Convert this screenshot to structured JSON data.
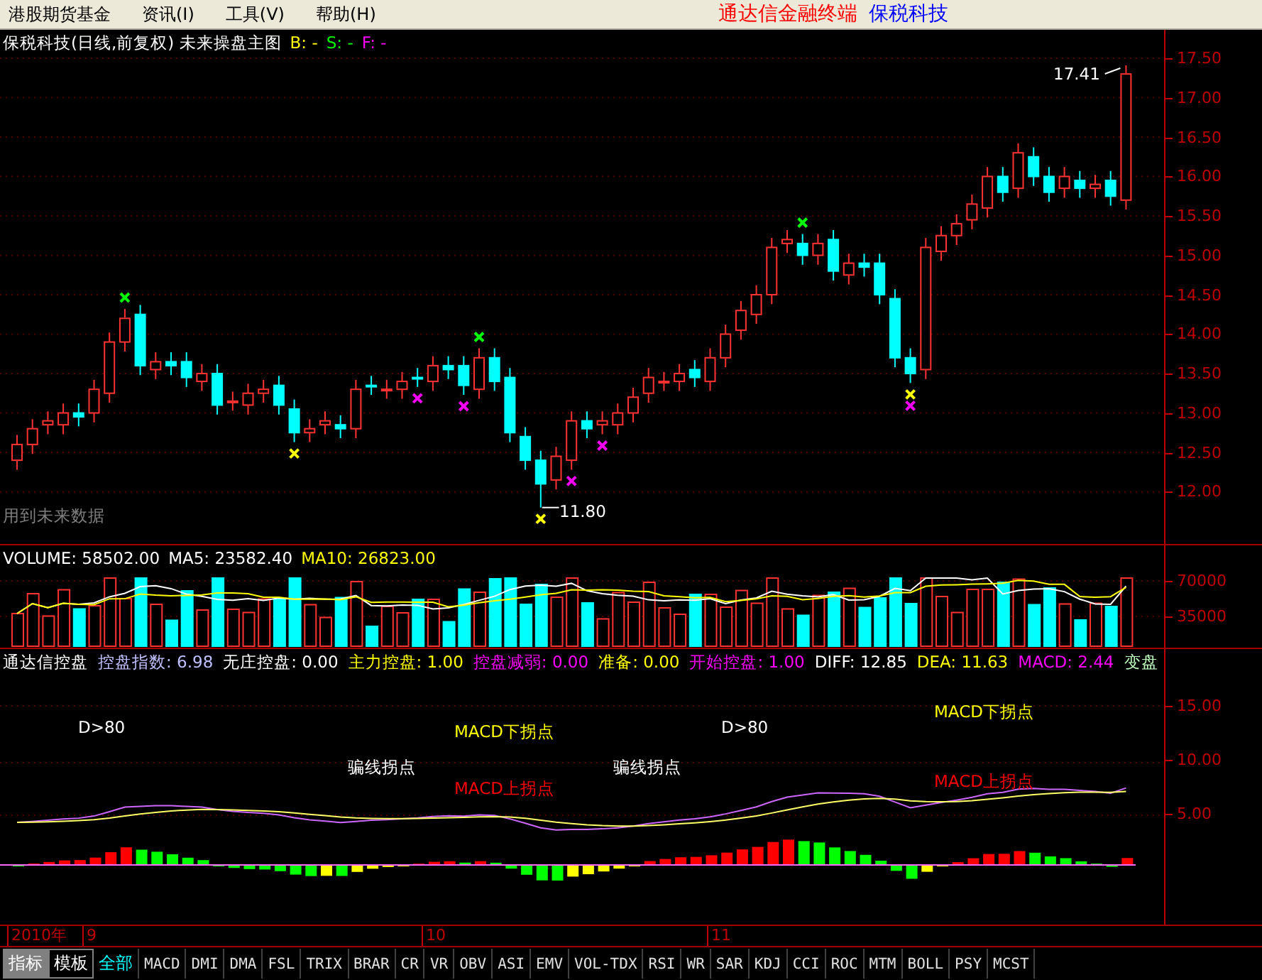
{
  "menu": {
    "items": [
      "港股期货基金",
      "资讯(I)",
      "工具(V)",
      "帮助(H)"
    ],
    "app_title": "通达信金融终端",
    "stock_name": "保税科技"
  },
  "main_chart": {
    "title": "保税科技(日线,前复权) 未来操盘主图",
    "signals": [
      {
        "label": "B: -",
        "color": "#ffff00"
      },
      {
        "label": "S: -",
        "color": "#00ff00"
      },
      {
        "label": "F: -",
        "color": "#ff00ff"
      }
    ],
    "axis_labels": [
      "17.50",
      "17.00",
      "16.50",
      "16.00",
      "15.50",
      "15.00",
      "14.50",
      "14.00",
      "13.50",
      "13.00",
      "12.50",
      "12.00"
    ],
    "high_label": "17.41",
    "low_label": "11.80",
    "note": "用到未来数据"
  },
  "volume": {
    "readings": [
      {
        "label": "VOLUME: 58502.00",
        "color": "#ffffff"
      },
      {
        "label": "MA5: 23582.40",
        "color": "#ffffff"
      },
      {
        "label": "MA10: 26823.00",
        "color": "#ffff00"
      }
    ],
    "axis_labels": [
      "70000",
      "35000"
    ]
  },
  "indicator": {
    "readings": [
      {
        "label": "通达信控盘",
        "color": "#ffffff"
      },
      {
        "label": "控盘指数: 6.98",
        "color": "#c0c0ff"
      },
      {
        "label": "无庄控盘: 0.00",
        "color": "#ffffff"
      },
      {
        "label": "主力控盘: 1.00",
        "color": "#ffff00"
      },
      {
        "label": "控盘减弱: 0.00",
        "color": "#ff00ff"
      },
      {
        "label": "准备: 0.00",
        "color": "#ffff00"
      },
      {
        "label": "开始控盘: 1.00",
        "color": "#ff00ff"
      },
      {
        "label": "DIFF: 12.85",
        "color": "#ffffff"
      },
      {
        "label": "DEA: 11.63",
        "color": "#ffff00"
      },
      {
        "label": "MACD: 2.44",
        "color": "#ff00ff"
      },
      {
        "label": "变盘",
        "color": "#c0ffc0"
      }
    ],
    "annotations": [
      {
        "text": "D>80",
        "color": "#ffffff"
      },
      {
        "text": "MACD下拐点",
        "color": "#ffff00"
      },
      {
        "text": "骗线拐点",
        "color": "#ffffff"
      },
      {
        "text": "MACD上拐点",
        "color": "#ff0000"
      },
      {
        "text": "骗线拐点",
        "color": "#ffffff"
      },
      {
        "text": "D>80",
        "color": "#ffffff"
      },
      {
        "text": "MACD下拐点",
        "color": "#ffff00"
      },
      {
        "text": "MACD上拐点",
        "color": "#ff0000"
      }
    ],
    "axis_labels": [
      "15.00",
      "10.00",
      "5.00"
    ]
  },
  "date_axis": [
    "2010年",
    "9",
    "10",
    "11"
  ],
  "mode_buttons": [
    {
      "label": "指标",
      "selected": true
    },
    {
      "label": "模板",
      "selected": false
    }
  ],
  "indicator_tabs": [
    {
      "label": "全部",
      "selected": true
    },
    {
      "label": "MACD",
      "selected": false
    },
    {
      "label": "DMI",
      "selected": false
    },
    {
      "label": "DMA",
      "selected": false
    },
    {
      "label": "FSL",
      "selected": false
    },
    {
      "label": "TRIX",
      "selected": false
    },
    {
      "label": "BRAR",
      "selected": false
    },
    {
      "label": "CR",
      "selected": false
    },
    {
      "label": "VR",
      "selected": false
    },
    {
      "label": "OBV",
      "selected": false
    },
    {
      "label": "ASI",
      "selected": false
    },
    {
      "label": "EMV",
      "selected": false
    },
    {
      "label": "VOL-TDX",
      "selected": false
    },
    {
      "label": "RSI",
      "selected": false
    },
    {
      "label": "WR",
      "selected": false
    },
    {
      "label": "SAR",
      "selected": false
    },
    {
      "label": "KDJ",
      "selected": false
    },
    {
      "label": "CCI",
      "selected": false
    },
    {
      "label": "ROC",
      "selected": false
    },
    {
      "label": "MTM",
      "selected": false
    },
    {
      "label": "BOLL",
      "selected": false
    },
    {
      "label": "PSY",
      "selected": false
    },
    {
      "label": "MCST",
      "selected": false
    }
  ]
}
